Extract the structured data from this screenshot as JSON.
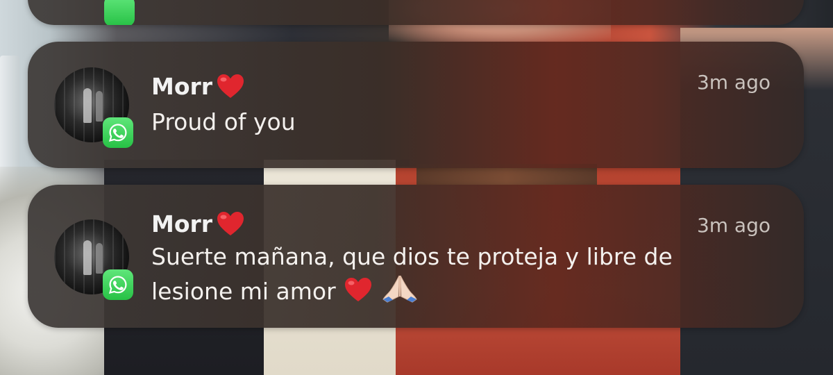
{
  "notifications": [
    {
      "sender": "Morr",
      "sender_emoji": "red-heart",
      "time": "3m ago",
      "app": "WhatsApp",
      "message_lines": [
        "Proud of you"
      ]
    },
    {
      "sender": "Morr",
      "sender_emoji": "red-heart",
      "time": "3m ago",
      "app": "WhatsApp",
      "message_lines": [
        "Suerte mañana, que dios te proteja y libre de",
        "lesione mi amor"
      ],
      "message_trailing_emojis": [
        "red-heart",
        "folded-hands"
      ]
    }
  ],
  "colors": {
    "whatsapp_green": "#27c145",
    "heart_red": "#e0262e",
    "text_primary": "#f2f2f2",
    "text_secondary": "#c9c2bd"
  }
}
